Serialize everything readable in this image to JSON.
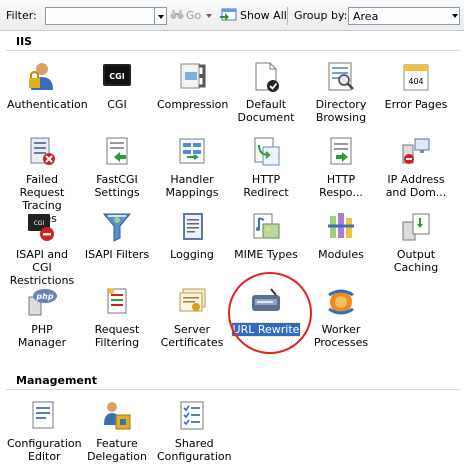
{
  "toolbar": {
    "filter_label": "Filter:",
    "filter_value": "",
    "go_label": "Go",
    "show_all_label": "Show All",
    "group_by_label": "Group by:",
    "group_by_value": "Area"
  },
  "sections": [
    {
      "title": "IIS",
      "items": [
        {
          "label": "Authentication",
          "icon": "authentication-icon"
        },
        {
          "label": "CGI",
          "icon": "cgi-icon"
        },
        {
          "label": "Compression",
          "icon": "compression-icon"
        },
        {
          "label": "Default Document",
          "icon": "default-document-icon"
        },
        {
          "label": "Directory Browsing",
          "icon": "directory-browsing-icon"
        },
        {
          "label": "Error Pages",
          "icon": "error-pages-icon"
        },
        {
          "label": "Failed Request Tracing Rules",
          "icon": "failed-request-tracing-icon"
        },
        {
          "label": "FastCGI Settings",
          "icon": "fastcgi-settings-icon"
        },
        {
          "label": "Handler Mappings",
          "icon": "handler-mappings-icon"
        },
        {
          "label": "HTTP Redirect",
          "icon": "http-redirect-icon"
        },
        {
          "label": "HTTP Respo...",
          "icon": "http-response-headers-icon"
        },
        {
          "label": "IP Address and Dom...",
          "icon": "ip-address-domain-icon"
        },
        {
          "label": "ISAPI and CGI Restrictions",
          "icon": "isapi-cgi-restrictions-icon"
        },
        {
          "label": "ISAPI Filters",
          "icon": "isapi-filters-icon"
        },
        {
          "label": "Logging",
          "icon": "logging-icon"
        },
        {
          "label": "MIME Types",
          "icon": "mime-types-icon"
        },
        {
          "label": "Modules",
          "icon": "modules-icon"
        },
        {
          "label": "Output Caching",
          "icon": "output-caching-icon"
        },
        {
          "label": "PHP Manager",
          "icon": "php-manager-icon"
        },
        {
          "label": "Request Filtering",
          "icon": "request-filtering-icon"
        },
        {
          "label": "Server Certificates",
          "icon": "server-certificates-icon"
        },
        {
          "label": "URL Rewrite",
          "icon": "url-rewrite-icon",
          "selected": true
        },
        {
          "label": "Worker Processes",
          "icon": "worker-processes-icon"
        }
      ]
    },
    {
      "title": "Management",
      "items": [
        {
          "label": "Configuration Editor",
          "icon": "configuration-editor-icon"
        },
        {
          "label": "Feature Delegation",
          "icon": "feature-delegation-icon"
        },
        {
          "label": "Shared Configuration",
          "icon": "shared-configuration-icon"
        }
      ]
    }
  ],
  "colors": {
    "selection": "#316ac5",
    "highlight_ring": "#e2231a"
  }
}
